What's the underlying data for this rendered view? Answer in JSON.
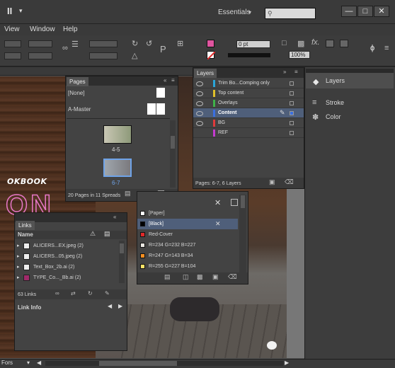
{
  "titlebar": {
    "app_icon": "II",
    "workspace": "Essentials",
    "workspace_caret": "▾",
    "search_placeholder": ""
  },
  "window_buttons": {
    "minimize": "—",
    "maximize": "□",
    "close": "✕"
  },
  "menu": [
    "View",
    "Window",
    "Help"
  ],
  "controlbar": {
    "stroke_weight": "0 pt",
    "zoom": "100%"
  },
  "lookbook_text": "OKBOOK",
  "big_title": "ON",
  "dock": {
    "items": [
      "Layers",
      "Stroke",
      "Color"
    ]
  },
  "pages_panel": {
    "tab": "Pages",
    "masters": [
      "[None]",
      "A-Master"
    ],
    "spreads": [
      "4-5",
      "6-7"
    ],
    "footer": "20 Pages in 11 Spreads"
  },
  "layers_panel": {
    "tab": "Layers",
    "layers": [
      {
        "name": "Trim Bo...Comping only",
        "color": "#2aa6d8"
      },
      {
        "name": "Top content",
        "color": "#e0c02a"
      },
      {
        "name": "Overlays",
        "color": "#3fb24a"
      },
      {
        "name": "Content",
        "color": "#3a6fe0"
      },
      {
        "name": "BG",
        "color": "#e03a3a"
      },
      {
        "name": "REF",
        "color": "#c43ad0"
      }
    ],
    "footer": "Pages: 6-7, 6 Layers"
  },
  "swatches_panel": {
    "swatches": [
      {
        "name": "[Paper]",
        "color": "#ffffff"
      },
      {
        "name": "[Black]",
        "color": "#000000"
      },
      {
        "name": "Red-Cover",
        "color": "#e02a2a"
      },
      {
        "name": "R=234 G=232 B=227",
        "color": "#eae8e3"
      },
      {
        "name": "R=247 G=143 B=34",
        "color": "#f78f22"
      },
      {
        "name": "R=255 G=227 B=104",
        "color": "#ffe368"
      }
    ]
  },
  "links_panel": {
    "tab": "Links",
    "column_name": "Name",
    "links": [
      "ALICERS...EX.jpeg (2)",
      "ALICERS...05.jpeg (2)",
      "Text_Box_2b.ai (2)",
      "TYPE_Co..._Bb.ai (2)"
    ],
    "count": "63 Links",
    "info_label": "Link Info"
  },
  "status": {
    "left": "Fors"
  }
}
